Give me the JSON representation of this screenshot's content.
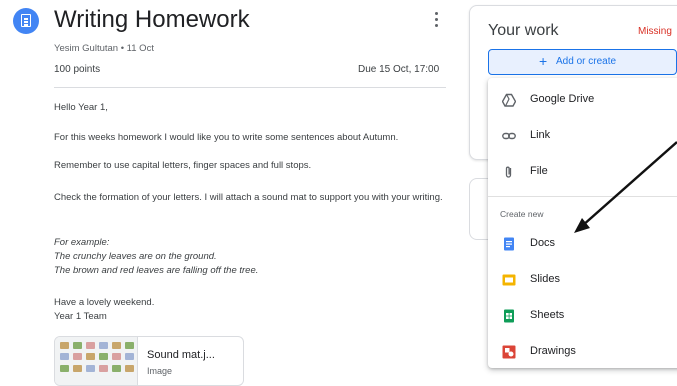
{
  "assignment": {
    "title": "Writing Homework",
    "author_date": "Yesim Gultutan • 11 Oct",
    "points": "100 points",
    "due": "Due 15 Oct, 17:00"
  },
  "body": {
    "greeting": "Hello Year 1,",
    "para1": "For this weeks homework I would like you to write some sentences about Autumn.",
    "para1b": "Remember to use capital letters, finger spaces and full stops.",
    "para2": "Check the formation of your letters. I will attach a sound mat to support you with your writing.",
    "example_label": "For example:",
    "example1": "The crunchy leaves are on the ground.",
    "example2": "The brown and red leaves are falling off the tree.",
    "signoff1": "Have a lovely weekend.",
    "signoff2": "Year 1 Team"
  },
  "attachment": {
    "name": "Sound mat.j...",
    "type": "Image"
  },
  "your_work": {
    "title": "Your work",
    "status": "Missing",
    "add_button": "Add or create",
    "add_icon": "plus-icon"
  },
  "menu": {
    "items": [
      {
        "label": "Google Drive",
        "icon": "google-drive-icon"
      },
      {
        "label": "Link",
        "icon": "link-icon"
      },
      {
        "label": "File",
        "icon": "paperclip-icon"
      }
    ],
    "create_new_label": "Create new",
    "create_items": [
      {
        "label": "Docs",
        "icon": "docs-icon",
        "color": "#4285f4"
      },
      {
        "label": "Slides",
        "icon": "slides-icon",
        "color": "#f4b400"
      },
      {
        "label": "Sheets",
        "icon": "sheets-icon",
        "color": "#0f9d58"
      },
      {
        "label": "Drawings",
        "icon": "drawings-icon",
        "color": "#db4437"
      }
    ]
  },
  "colors": {
    "accent": "#1a73e8",
    "missing": "#d93025"
  }
}
